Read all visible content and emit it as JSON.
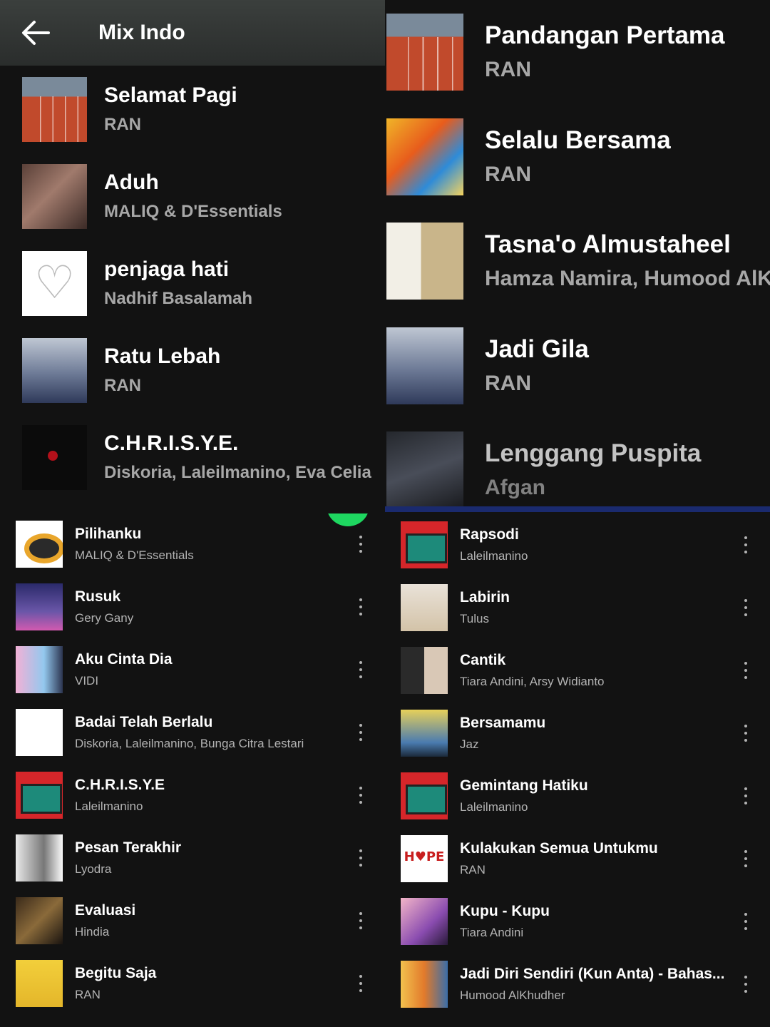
{
  "header": {
    "title": "Mix Indo",
    "back_icon": "arrow-left-icon"
  },
  "top_left_list": [
    {
      "title": "Selamat Pagi",
      "artist": "RAN",
      "art": "track"
    },
    {
      "title": "Aduh",
      "artist": "MALIQ & D'Essentials",
      "art": "hands"
    },
    {
      "title": "penjaga hati",
      "artist": "Nadhif Basalamah",
      "art": "heart"
    },
    {
      "title": "Ratu Lebah",
      "artist": "RAN",
      "art": "group"
    },
    {
      "title": "C.H.R.I.S.Y.E.",
      "artist": "Diskoria, Laleilmanino, Eva Celia",
      "art": "dark"
    }
  ],
  "top_right_list": [
    {
      "title": "Pandangan Pertama",
      "artist": "RAN",
      "art": "track"
    },
    {
      "title": "Selalu Bersama",
      "artist": "RAN",
      "art": "colorful"
    },
    {
      "title": "Tasna'o Almustaheel",
      "artist": "Hamza Namira, Humood AlKh",
      "art": "arab"
    },
    {
      "title": "Jadi Gila",
      "artist": "RAN",
      "art": "group"
    },
    {
      "title": "Lenggang Puspita",
      "artist": "Afgan",
      "art": "afgan"
    }
  ],
  "bottom_left_list": [
    {
      "title": "Pilihanku",
      "artist": "MALIQ & D'Essentials",
      "art": "eye"
    },
    {
      "title": "Rusuk",
      "artist": "Gery Gany",
      "art": "purple"
    },
    {
      "title": "Aku Cinta Dia",
      "artist": "VIDI",
      "art": "pinkblue"
    },
    {
      "title": "Badai Telah Berlalu",
      "artist": "Diskoria, Laleilmanino, Bunga Citra Lestari",
      "art": "white"
    },
    {
      "title": "C.H.R.I.S.Y.E",
      "artist": "Laleilmanino",
      "art": "cassette"
    },
    {
      "title": "Pesan Terakhir",
      "artist": "Lyodra",
      "art": "bw"
    },
    {
      "title": "Evaluasi",
      "artist": "Hindia",
      "art": "brownblur"
    },
    {
      "title": "Begitu Saja",
      "artist": "RAN",
      "art": "yellowband"
    }
  ],
  "bottom_right_list": [
    {
      "title": "Rapsodi",
      "artist": "Laleilmanino",
      "art": "cassette"
    },
    {
      "title": "Labirin",
      "artist": "Tulus",
      "art": "tulus"
    },
    {
      "title": "Cantik",
      "artist": "Tiara Andini, Arsy Widianto",
      "art": "couple"
    },
    {
      "title": "Bersamamu",
      "artist": "Jaz",
      "art": "jaz"
    },
    {
      "title": "Gemintang Hatiku",
      "artist": "Laleilmanino",
      "art": "cassette"
    },
    {
      "title": "Kulakukan Semua Untukmu",
      "artist": "RAN",
      "art": "hope"
    },
    {
      "title": "Kupu - Kupu",
      "artist": "Tiara Andini",
      "art": "kupu"
    },
    {
      "title": "Jadi Diri Sendiri (Kun Anta) - Bahas...",
      "artist": "Humood AlKhudher",
      "art": "kun"
    }
  ],
  "more_icon": "more-vertical-icon",
  "colors": {
    "background": "#121212",
    "secondary_text": "#a7a7a7",
    "accent_green": "#1ed760",
    "progress_blue": "#1a2a6e"
  }
}
